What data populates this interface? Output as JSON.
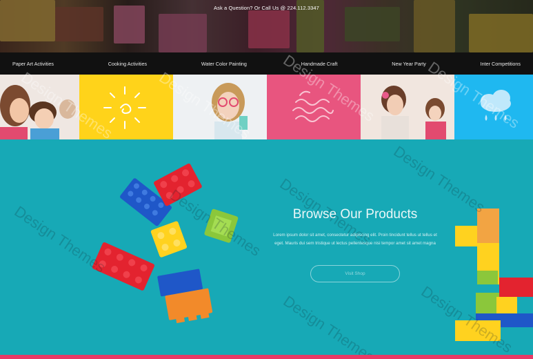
{
  "header": {
    "contact_text": "Ask a Question? Or Call Us @ 224.112.3347"
  },
  "nav": {
    "items": [
      "Paper Art Activities",
      "Cooking Activities",
      "Water Color Painting",
      "Handmade Craft",
      "New Year Party",
      "Inter Competitions"
    ]
  },
  "tiles": {
    "colors": [
      "#f7dcc9",
      "#ffd31a",
      "#e8eef2",
      "#e8557f",
      "#e9d9cf",
      "#1fb8f0"
    ],
    "icons": [
      "sun-icon",
      "waves-icon",
      "rain-cloud-icon"
    ]
  },
  "product": {
    "title": "Browse Our Products",
    "description": "Lorem ipsum dolor sit amet, consectetur adipiscing elit. Proin tincidunt tellus ut tellus et eget. Mauris dui sem tristique ut lectus pellentesque nisi tempor amet sit amet magna",
    "button_label": "Visit Shop",
    "background_color": "#17a9b6"
  },
  "watermark": {
    "text": "Design Themes"
  },
  "colors": {
    "accent_pink": "#e83a67",
    "nav_bg": "#111111"
  }
}
